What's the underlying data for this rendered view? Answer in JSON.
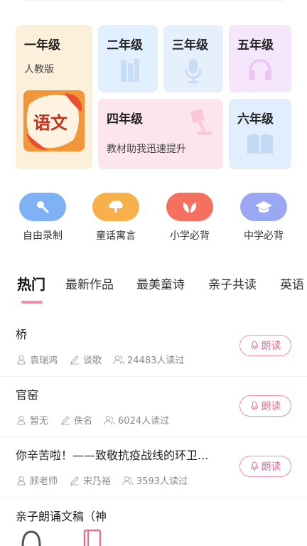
{
  "grades": {
    "g1": {
      "title": "一年级",
      "sub": "人教版",
      "cover_text": "语文"
    },
    "g2": {
      "title": "二年级"
    },
    "g3": {
      "title": "三年级"
    },
    "g5": {
      "title": "五年级"
    },
    "g4": {
      "title": "四年级",
      "sub": "教材助我迅速提升"
    },
    "g6": {
      "title": "六年级"
    }
  },
  "categories": [
    {
      "label": "自由录制",
      "color": "#7fb2f5",
      "icon": "microphone-icon"
    },
    {
      "label": "童话寓言",
      "color": "#f7b04a",
      "icon": "tree-icon"
    },
    {
      "label": "小学必背",
      "color": "#f4715f",
      "icon": "leaf-icon"
    },
    {
      "label": "中学必背",
      "color": "#9aa7f3",
      "icon": "graduation-cap-icon"
    }
  ],
  "tabs": [
    "热门",
    "最新作品",
    "最美童诗",
    "亲子共读",
    "英语"
  ],
  "items": [
    {
      "title": "桥",
      "reader": "袁瑞鸿",
      "author": "谈歌",
      "reads": "24483人读过",
      "action": "朗读"
    },
    {
      "title": "官窑",
      "reader": "暂无",
      "author": "佚名",
      "reads": "6024人读过",
      "action": "朗读"
    },
    {
      "title": "你辛苦啦！——致敬抗疫战线的环卫...",
      "reader": "顾老师",
      "author": "宋乃裕",
      "reads": "3593人读过",
      "action": "朗读"
    },
    {
      "title": "亲子朗诵文稿（神"
    }
  ],
  "colors": {
    "accent": "#e56f96"
  }
}
